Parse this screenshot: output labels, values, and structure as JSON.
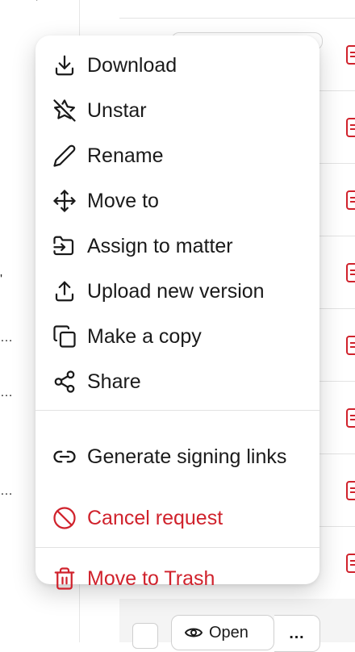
{
  "menu": {
    "items": [
      {
        "label": "Download",
        "icon": "download-icon"
      },
      {
        "label": "Unstar",
        "icon": "star-off-icon"
      },
      {
        "label": "Rename",
        "icon": "pencil-icon"
      },
      {
        "label": "Move to",
        "icon": "move-arrows-icon"
      },
      {
        "label": "Assign to matter",
        "icon": "folder-input-icon"
      },
      {
        "label": "Upload new version",
        "icon": "upload-icon"
      },
      {
        "label": "Make a copy",
        "icon": "copy-icon"
      },
      {
        "label": "Share",
        "icon": "share-icon"
      },
      {
        "label": "Generate signing links",
        "icon": "link-icon"
      },
      {
        "label": "Cancel request",
        "icon": "ban-icon"
      },
      {
        "label": "Move to Trash",
        "icon": "trash-icon"
      }
    ]
  },
  "background": {
    "open_button_label": "Open",
    "more_button_label": "…",
    "truncated_text": [
      "…",
      "…",
      "…"
    ]
  },
  "colors": {
    "danger": "#d0222c",
    "text": "#1a1a1a",
    "divider": "#e2e2e2"
  }
}
